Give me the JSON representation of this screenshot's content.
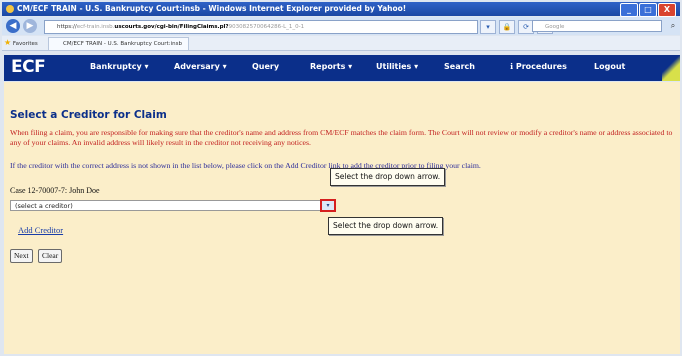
{
  "window": {
    "title": "CM/ECF TRAIN - U.S. Bankruptcy Court:insb - Windows Internet Explorer provided by Yahoo!",
    "buttons": [
      "_",
      "□",
      "X"
    ]
  },
  "address_bar": {
    "scheme": "https://",
    "host": "ecf-train.insb.",
    "path_strong": "uscourts.gov/cgi-bin/FilingClaims.pl?",
    "query": "903082570064286-L_1_0-1",
    "search_placeholder": "Google"
  },
  "favorites_bar": {
    "favorites_label": "Favorites",
    "tab_label": "CM/ECF TRAIN - U.S. Bankruptcy Court:insb"
  },
  "ecf_menu": {
    "logo": "ECF",
    "items": [
      "Bankruptcy",
      "Adversary",
      "Query",
      "Reports",
      "Utilities",
      "Search",
      "Procedures",
      "Logout"
    ],
    "dropdown_markers": [
      "▾",
      "▾",
      "",
      "▾",
      "▾",
      "",
      "",
      ""
    ]
  },
  "main": {
    "page_title": "Select a Creditor for Claim",
    "warning": "When filing a claim, you are responsible for making sure that the creditor's name and address from CM/ECF matches the claim form. The Court will not review or modify a creditor's name or address associated to any of your claims. An invalid address will likely result in the creditor not receiving any notices.",
    "info": "If the creditor with the correct address is not shown in the list below, please click on the Add Creditor link to add the creditor prior to filing your claim.",
    "case_line": "Case 12-70007-7: John Doe",
    "creditor_select_value": "(select a creditor)",
    "add_creditor_link": "Add Creditor",
    "next_button": "Next",
    "clear_button": "Clear"
  },
  "callouts": {
    "top": "Select the drop down arrow.",
    "bottom": "Select the drop down arrow."
  },
  "colors": {
    "menu_bg": "#0b2f8a",
    "content_bg": "#fbeec9",
    "warning_text": "#c11e1e",
    "highlight_border": "#d51f1f"
  }
}
